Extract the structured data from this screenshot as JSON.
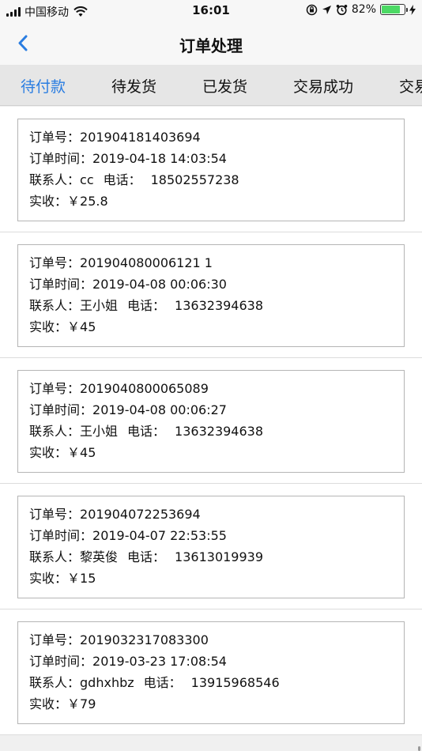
{
  "status_bar": {
    "carrier": "中国移动",
    "time": "16:01",
    "battery_percent": "82%",
    "battery_level": 0.82
  },
  "nav": {
    "title": "订单处理"
  },
  "tabs": [
    {
      "label": "待付款",
      "active": true
    },
    {
      "label": "待发货",
      "active": false
    },
    {
      "label": "已发货",
      "active": false
    },
    {
      "label": "交易成功",
      "active": false
    },
    {
      "label": "交易",
      "active": false
    }
  ],
  "field_labels": {
    "order_no": "订单号：",
    "order_time": "订单时间：",
    "contact": "联系人：",
    "phone": "电话：",
    "received": "实收："
  },
  "orders": [
    {
      "order_no": "201904181403694",
      "order_time": "2019-04-18 14:03:54",
      "contact": "cc",
      "phone": "18502557238",
      "received": "￥25.8"
    },
    {
      "order_no": "201904080006121 1",
      "order_time": "2019-04-08 00:06:30",
      "contact": "王小姐",
      "phone": "13632394638",
      "received": "￥45"
    },
    {
      "order_no": "2019040800065089",
      "order_time": "2019-04-08 00:06:27",
      "contact": "王小姐",
      "phone": "13632394638",
      "received": "￥45"
    },
    {
      "order_no": "201904072253694",
      "order_time": "2019-04-07 22:53:55",
      "contact": "黎英俊",
      "phone": "13613019939",
      "received": "￥15"
    },
    {
      "order_no": "2019032317083300",
      "order_time": "2019-03-23 17:08:54",
      "contact": "gdhxhbz",
      "phone": "13915968546",
      "received": "￥79"
    }
  ],
  "colors": {
    "accent": "#2a7de1",
    "battery_fill": "#4cd964"
  }
}
